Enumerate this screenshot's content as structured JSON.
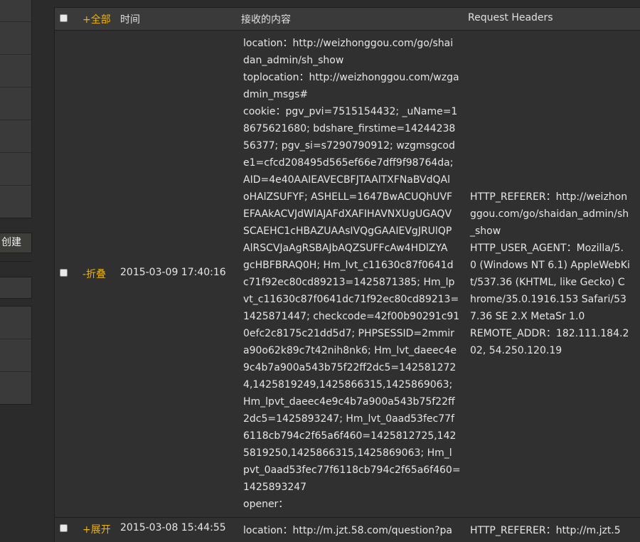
{
  "sidebar": {
    "create_button_label": "创建"
  },
  "table": {
    "headers": {
      "toggle_all": "+全部",
      "time": "时间",
      "received": "接收的内容",
      "request_headers": "Request Headers"
    },
    "rows": [
      {
        "toggle": "-折叠",
        "time": "2015-03-09 17:40:16",
        "content_lines": [
          "location：http://weizhonggou.com/go/shai",
          "dan_admin/sh_show",
          "toplocation：http://weizhonggou.com/wzga",
          "dmin_msgs#",
          "cookie：pgv_pvi=7515154432; _uName=1",
          "8675621680; bdshare_firstime=14244238",
          "56377; pgv_si=s7290790912; wzgmsgcod",
          "e1=cfcd208495d565ef66e7dff9f98764da;",
          "AID=4e40AAIEAVECBFJTAAlTXFNaBVdQAl",
          "oHAlZSUFYF; ASHELL=1647BwACUQhUVF",
          "EFAAkACVJdWlAJAFdXAFIHAVNXUgUGAQV",
          "SCAEHC1cHBAZUAAsIVQgGAAIEVgJRUlQP",
          "AlRSCVJaAgRSBAJbAQZSUFFcAw4HDlZYA",
          "gcHBFBRAQ0H; Hm_lvt_c11630c87f0641d",
          "c71f92ec80cd89213=1425871385; Hm_lp",
          "vt_c11630c87f0641dc71f92ec80cd89213=",
          "1425871447; checkcode=42f00b90291c91",
          "0efc2c8175c21dd5d7; PHPSESSID=2mmir",
          "a90o62k89c7t42nih8nk6; Hm_lvt_daeec4e",
          "9c4b7a900a543b75f22ff2dc5=142581272",
          "4,1425819249,1425866315,1425869063;",
          "Hm_lpvt_daeec4e9c4b7a900a543b75f22ff",
          "2dc5=1425893247; Hm_lvt_0aad53fec77f",
          "6118cb794c2f65a6f460=1425812725,142",
          "5819250,1425866315,1425869063; Hm_l",
          "pvt_0aad53fec77f6118cb794c2f65a6f460=",
          "1425893247",
          "opener："
        ],
        "header_lines": [
          "HTTP_REFERER：http://weizhon",
          "ggou.com/go/shaidan_admin/sh",
          "_show",
          "HTTP_USER_AGENT：Mozilla/5.",
          "0 (Windows NT 6.1) AppleWebKi",
          "t/537.36 (KHTML, like Gecko) C",
          "hrome/35.0.1916.153 Safari/53",
          "7.36 SE 2.X MetaSr 1.0",
          "REMOTE_ADDR：182.111.184.2",
          "02, 54.250.120.19"
        ]
      },
      {
        "toggle": "+展开",
        "time": "2015-03-08 15:44:55",
        "content_preview": "location：http://m.jzt.58.com/question?pa",
        "headers_preview": "HTTP_REFERER：http://m.jzt.5"
      }
    ]
  },
  "colors": {
    "background": "#2b2b2b",
    "accent_toggle": "#f0b400",
    "text": "#e6e6e6"
  }
}
